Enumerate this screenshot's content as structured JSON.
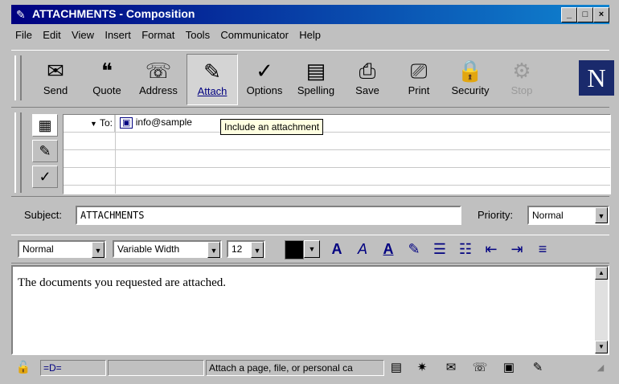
{
  "window": {
    "title": "ATTACHMENTS - Composition"
  },
  "menu": [
    "File",
    "Edit",
    "View",
    "Insert",
    "Format",
    "Tools",
    "Communicator",
    "Help"
  ],
  "toolbar": {
    "buttons": [
      {
        "label": "Send",
        "icon": "send-icon"
      },
      {
        "label": "Quote",
        "icon": "quote-icon"
      },
      {
        "label": "Address",
        "icon": "address-icon"
      },
      {
        "label": "Attach",
        "icon": "attach-icon",
        "state": "pressed"
      },
      {
        "label": "Options",
        "icon": "options-icon"
      },
      {
        "label": "Spelling",
        "icon": "spelling-icon"
      },
      {
        "label": "Save",
        "icon": "save-icon"
      },
      {
        "label": "Print",
        "icon": "print-icon"
      },
      {
        "label": "Security",
        "icon": "security-icon"
      },
      {
        "label": "Stop",
        "icon": "stop-icon",
        "state": "disabled"
      }
    ],
    "logo": "N"
  },
  "address": {
    "rows": [
      {
        "field": "To:",
        "value": "info@sample"
      }
    ]
  },
  "tooltip": "Include an attachment",
  "subject": {
    "label": "Subject:",
    "value": "ATTACHMENTS"
  },
  "priority": {
    "label": "Priority:",
    "value": "Normal"
  },
  "format": {
    "paragraph_style": "Normal",
    "font": "Variable Width",
    "size": "12",
    "text_color": "#000000"
  },
  "body": {
    "text": "The documents you requested are attached."
  },
  "status": {
    "message": "Attach a page, file, or personal ca"
  }
}
